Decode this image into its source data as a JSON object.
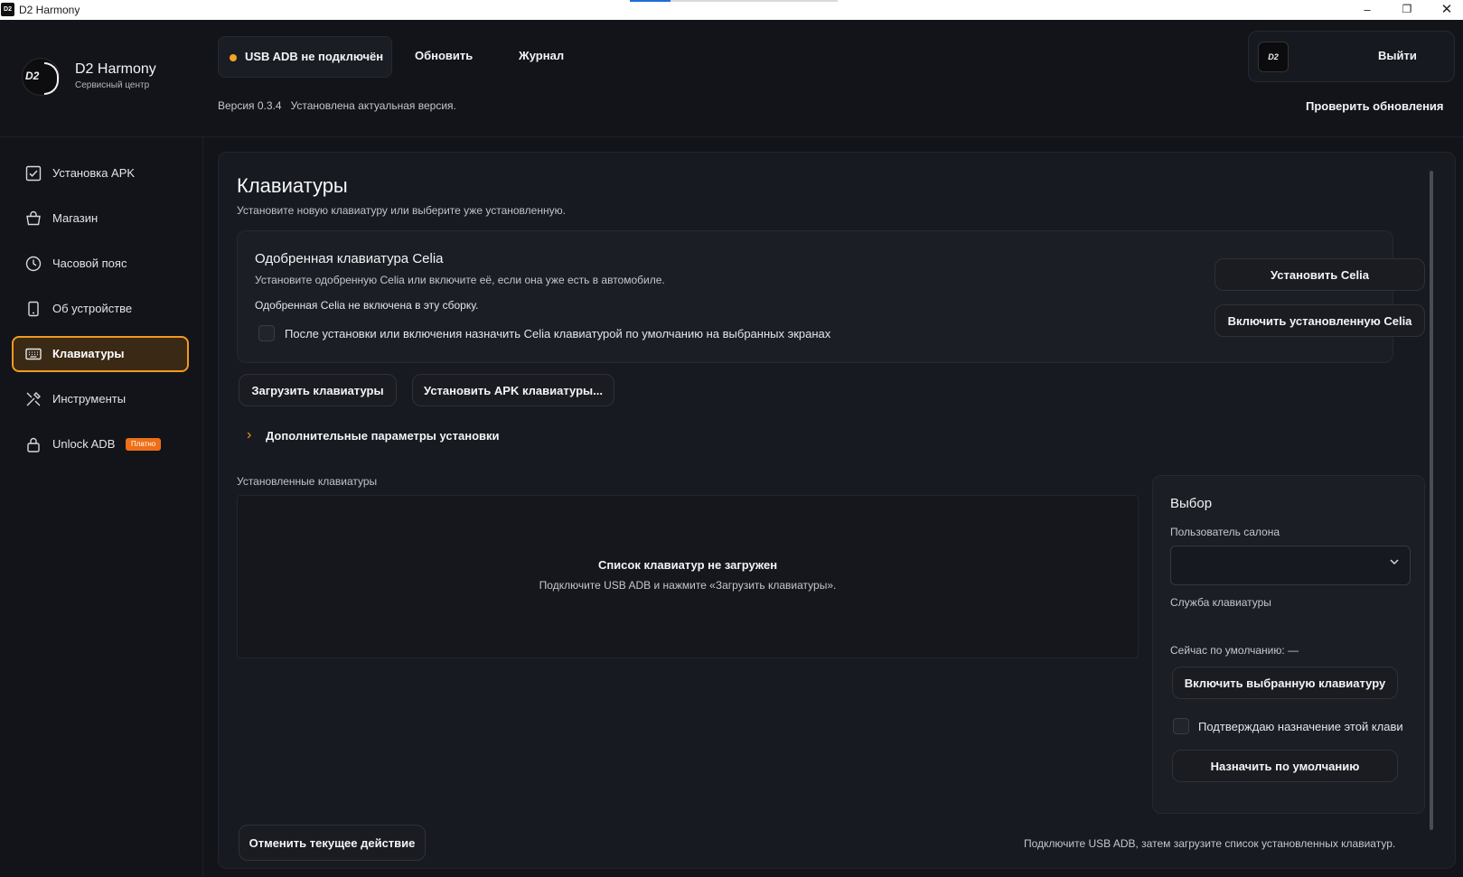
{
  "window": {
    "title": "D2 Harmony",
    "app_icon": "D2"
  },
  "header": {
    "logo_text": "D2",
    "brand": "D2 Harmony",
    "brand_sub": "Сервисный центр",
    "status": "USB ADB не подключён",
    "status_color": "#f5a524",
    "refresh": "Обновить",
    "log": "Журнал",
    "version": "Версия 0.3.4",
    "version_status": "Установлена актуальная версия.",
    "check_updates": "Проверить обновления",
    "avatar_text": "D2",
    "logout": "Выйти"
  },
  "sidebar": {
    "items": [
      {
        "label": "Установка APK",
        "icon": "checkbox-icon"
      },
      {
        "label": "Магазин",
        "icon": "basket-icon"
      },
      {
        "label": "Часовой пояс",
        "icon": "clock-icon"
      },
      {
        "label": "Об устройстве",
        "icon": "phone-icon"
      },
      {
        "label": "Клавиатуры",
        "icon": "keyboard-icon",
        "active": true
      },
      {
        "label": "Инструменты",
        "icon": "tools-icon"
      },
      {
        "label": "Unlock ADB",
        "icon": "lock-icon",
        "badge": "Платно"
      }
    ],
    "accent": "#f29a1f"
  },
  "main": {
    "title": "Клавиатуры",
    "subtitle": "Установите новую клавиатуру или выберите уже установленную.",
    "celia": {
      "title": "Одобренная клавиатура Celia",
      "desc": "Установите одобренную Celia или включите её, если она уже есть в автомобиле.",
      "note": "Одобренная Celia не включена в эту сборку.",
      "checkbox_label": "После установки или включения назначить Celia клавиатурой по умолчанию на выбранных экранах",
      "install_btn": "Установить Celia",
      "enable_btn": "Включить установленную Celia"
    },
    "load_btn": "Загрузить клавиатуры",
    "install_apk_btn": "Установить APK клавиатуры...",
    "advanced": "Дополнительные параметры установки",
    "installed_label": "Установленные клавиатуры",
    "empty_title": "Список клавиатур не загружен",
    "empty_desc": "Подключите USB ADB и нажмите «Загрузить клавиатуры».",
    "selection": {
      "title": "Выбор",
      "user_label": "Пользователь салона",
      "user_value": "",
      "service_label": "Служба клавиатуры",
      "default_now": "Сейчас по умолчанию: —",
      "enable_btn": "Включить выбранную клавиатуру",
      "confirm_label": "Подтверждаю назначение этой клави",
      "assign_btn": "Назначить по умолчанию"
    },
    "cancel_btn": "Отменить текущее действие",
    "footer_hint": "Подключите USB ADB, затем загрузите список установленных клавиатур."
  }
}
